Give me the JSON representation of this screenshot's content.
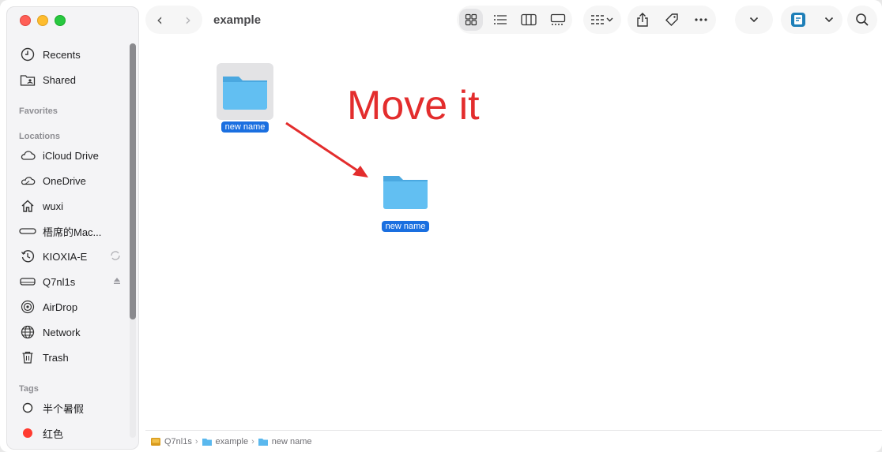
{
  "window": {
    "title": "example"
  },
  "sidebar": {
    "top_items": [
      {
        "label": "Recents",
        "icon": "clock-icon"
      },
      {
        "label": "Shared",
        "icon": "shared-folder-icon"
      }
    ],
    "favorites_heading": "Favorites",
    "locations_heading": "Locations",
    "locations": [
      {
        "label": "iCloud Drive",
        "icon": "cloud-icon"
      },
      {
        "label": "OneDrive",
        "icon": "onedrive-icon"
      },
      {
        "label": "wuxi",
        "icon": "home-icon"
      },
      {
        "label": "梧席的Mac...",
        "icon": "computer-icon"
      },
      {
        "label": "KIOXIA-E",
        "icon": "time-machine-icon"
      },
      {
        "label": "Q7nl1s",
        "icon": "drive-icon"
      },
      {
        "label": "AirDrop",
        "icon": "airdrop-icon"
      },
      {
        "label": "Network",
        "icon": "globe-icon"
      },
      {
        "label": "Trash",
        "icon": "trash-icon"
      }
    ],
    "tags_heading": "Tags",
    "tags": [
      {
        "label": "半个暑假",
        "color": "#ffffff"
      },
      {
        "label": "红色",
        "color": "#ff3b30"
      }
    ]
  },
  "files": [
    {
      "name": "new name",
      "selected": true
    },
    {
      "name": "new name",
      "selected": false
    }
  ],
  "annotation": {
    "text": "Move it",
    "color": "#e32d2d"
  },
  "pathbar": {
    "crumbs": [
      "Q7nl1s",
      "example",
      "new name"
    ]
  },
  "colors": {
    "accent": "#1a6fe0",
    "folder": "#5ab8ee"
  }
}
